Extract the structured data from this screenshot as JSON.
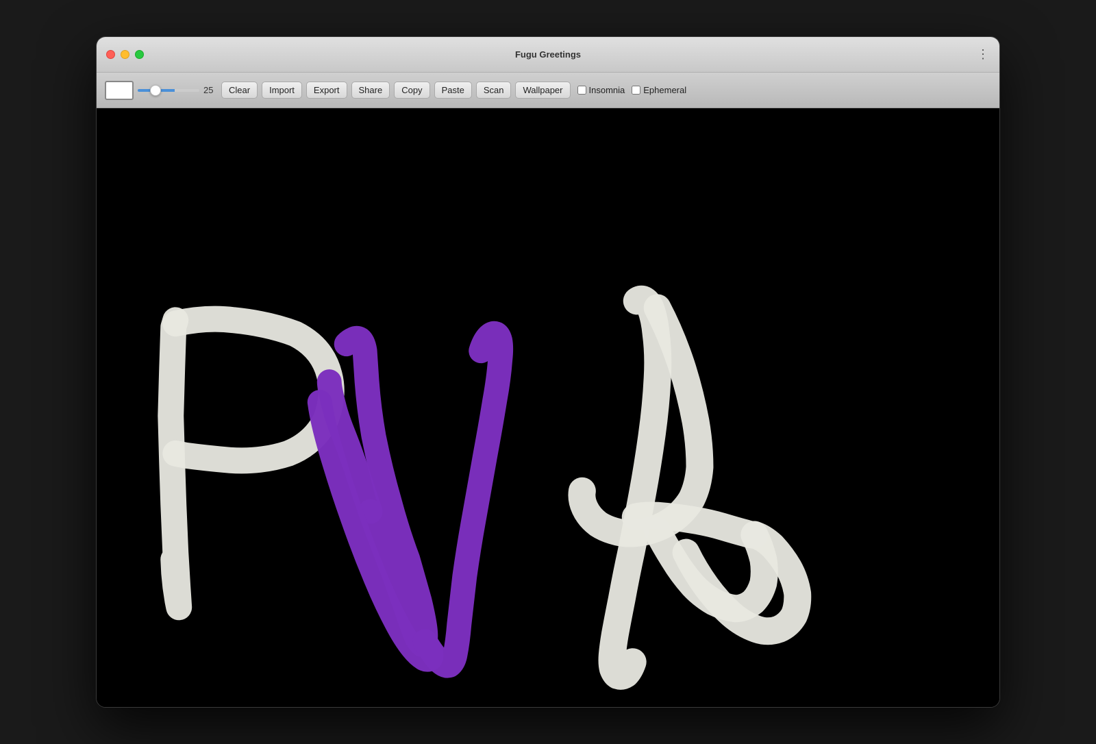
{
  "window": {
    "title": "Fugu Greetings",
    "background": "#000000"
  },
  "titlebar": {
    "title": "Fugu Greetings",
    "menu_icon": "⋮",
    "traffic_lights": {
      "close_color": "#ff5f57",
      "minimize_color": "#ffbd2e",
      "maximize_color": "#28c940"
    }
  },
  "toolbar": {
    "color_swatch_color": "#ffffff",
    "brush_size": "25",
    "slider_value": 60,
    "buttons": {
      "clear": "Clear",
      "import": "Import",
      "export": "Export",
      "share": "Share",
      "copy": "Copy",
      "paste": "Paste",
      "scan": "Scan",
      "wallpaper": "Wallpaper"
    },
    "checkboxes": {
      "insomnia_label": "Insomnia",
      "insomnia_checked": false,
      "ephemeral_label": "Ephemeral",
      "ephemeral_checked": false
    }
  }
}
